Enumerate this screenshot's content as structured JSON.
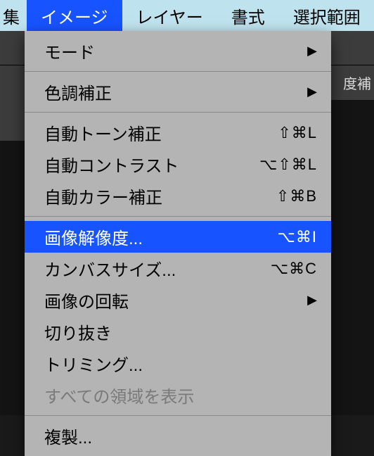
{
  "menubar": {
    "partial_left": "集",
    "items": [
      "イメージ",
      "レイヤー",
      "書式",
      "選択範囲"
    ],
    "active_index": 0
  },
  "toolbar": {
    "right_text_partial": "度補"
  },
  "dropdown_items": [
    {
      "label": "モード",
      "type": "submenu"
    },
    {
      "label": "-",
      "type": "separator"
    },
    {
      "label": "色調補正",
      "type": "submenu"
    },
    {
      "label": "-",
      "type": "separator"
    },
    {
      "label": "自動トーン補正",
      "type": "item",
      "shortcut": "⇧⌘L"
    },
    {
      "label": "自動コントラスト",
      "type": "item",
      "shortcut": "⌥⇧⌘L"
    },
    {
      "label": "自動カラー補正",
      "type": "item",
      "shortcut": "⇧⌘B"
    },
    {
      "label": "-",
      "type": "separator"
    },
    {
      "label": "画像解像度...",
      "type": "item",
      "shortcut": "⌥⌘I",
      "highlighted": true
    },
    {
      "label": "カンバスサイズ...",
      "type": "item",
      "shortcut": "⌥⌘C"
    },
    {
      "label": "画像の回転",
      "type": "submenu"
    },
    {
      "label": "切り抜き",
      "type": "item"
    },
    {
      "label": "トリミング...",
      "type": "item"
    },
    {
      "label": "すべての領域を表示",
      "type": "item",
      "disabled": true
    },
    {
      "label": "-",
      "type": "separator"
    },
    {
      "label": "複製...",
      "type": "item"
    }
  ]
}
